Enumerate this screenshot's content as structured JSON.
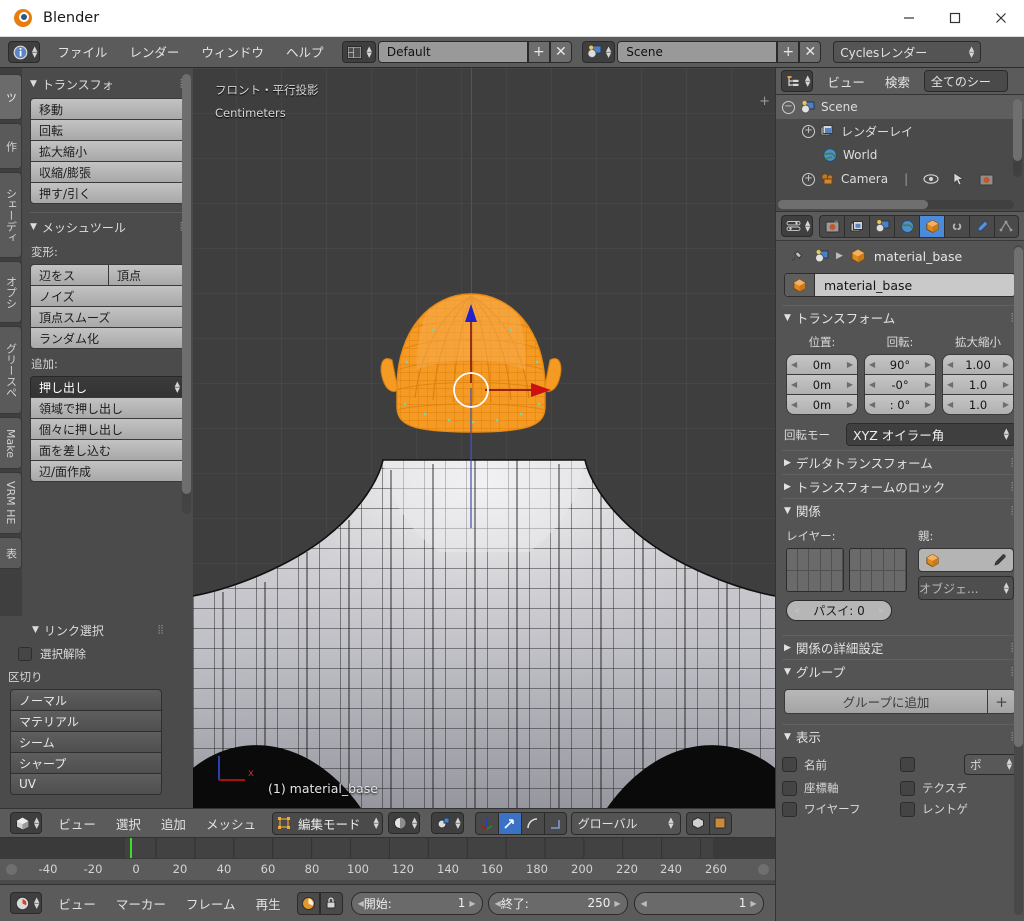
{
  "window": {
    "title": "Blender",
    "minimize_label": "—",
    "maximize_label": "□",
    "close_label": "✕"
  },
  "topbar": {
    "editor_icon": "info-editor-icon",
    "menus": [
      "ファイル",
      "レンダー",
      "ウィンドウ",
      "ヘルプ"
    ],
    "screen_layout": "Default",
    "screen_add": "+",
    "screen_remove": "✕",
    "scene_name": "Scene",
    "scene_add": "+",
    "scene_remove": "✕",
    "render_engine": "Cyclesレンダー"
  },
  "toolshelf": {
    "vertical_tabs": [
      {
        "label": "ツ",
        "active": true
      },
      {
        "label": "作",
        "active": false
      },
      {
        "label": "シェーディ",
        "active": false
      },
      {
        "label": "オプシ",
        "active": false
      },
      {
        "label": "グリースペ",
        "active": false
      },
      {
        "label": "Make",
        "active": false
      },
      {
        "label": "VRM HE",
        "active": false
      },
      {
        "label": "表",
        "active": false
      }
    ],
    "transform_panel": {
      "title": "トランスフォ",
      "buttons": [
        "移動",
        "回転",
        "拡大縮小",
        "収縮/膨張",
        "押す/引く"
      ]
    },
    "mesh_tools_panel": {
      "title": "メッシュツール",
      "deform_label": "変形:",
      "deform_split": [
        "辺をス",
        "頂点"
      ],
      "deform_buttons": [
        "ノイズ",
        "頂点スムーズ",
        "ランダム化"
      ],
      "add_label": "追加:",
      "add_active": "押し出し",
      "add_buttons": [
        "領域で押し出し",
        "個々に押し出し",
        "面を差し込む",
        "辺/面作成"
      ]
    },
    "link_select_panel": {
      "title": "リンク選択",
      "deselect_label": "選択解除",
      "delimit_label": "区切り",
      "delimit_buttons": [
        "ノーマル",
        "マテリアル",
        "シーム",
        "シャープ",
        "UV"
      ]
    }
  },
  "viewport": {
    "view_label": "フロント・平行投影",
    "unit_label": "Centimeters",
    "object_info": "(1) material_base",
    "axis_x_label": "x",
    "mesh_color": "#f59a23",
    "z_axis_color": "#3a4fa8",
    "x_axis_color": "#c31c1c",
    "toggle_panel": "+"
  },
  "viewport_header": {
    "editor_icon": "3d-view-editor-icon",
    "menus": [
      "ビュー",
      "選択",
      "追加",
      "メッシュ"
    ],
    "mode": "編集モード",
    "shading_icon": "solid-shading-icon",
    "pivot_icon": "pivot-median-icon",
    "manipulator_icons": [
      "translate-manipulator-icon",
      "rotate-manipulator-icon",
      "scale-manipulator-icon"
    ],
    "manipulator_active_index": 0,
    "orientation": "グローバル"
  },
  "timeline": {
    "ticks": [
      "-40",
      "-20",
      "0",
      "20",
      "40",
      "60",
      "80",
      "100",
      "120",
      "140",
      "160",
      "180",
      "200",
      "220",
      "240",
      "260"
    ],
    "playhead_frame": 0,
    "menus": [
      "ビュー",
      "マーカー",
      "フレーム",
      "再生"
    ],
    "start_label": "開始:",
    "start_value": "1",
    "end_label": "終了:",
    "end_value": "250",
    "current_frame": "1",
    "auto_key_icon": "auto-keyframe-icon",
    "lock_icon": "lock-icon"
  },
  "outliner": {
    "editor_icon": "outliner-editor-icon",
    "menus": [
      "ビュー",
      "検索"
    ],
    "display_mode": "全てのシー",
    "rows": [
      {
        "label": "Scene",
        "icon": "scene-icon",
        "indent": 0,
        "expander": "−",
        "selected": true
      },
      {
        "label": "レンダーレイ",
        "icon": "render-layers-icon",
        "indent": 1,
        "expander": "+",
        "selected": false
      },
      {
        "label": "World",
        "icon": "world-icon",
        "indent": 1,
        "expander": "",
        "selected": false
      },
      {
        "label": "Camera",
        "icon": "camera-icon",
        "indent": 1,
        "expander": "+",
        "selected": false
      }
    ],
    "row_icons": [
      "eye-icon",
      "cursor-icon",
      "render-icon"
    ]
  },
  "properties": {
    "tabs": [
      {
        "name": "render-tab-icon",
        "active": false
      },
      {
        "name": "render-layers-tab-icon",
        "active": false
      },
      {
        "name": "scene-tab-icon",
        "active": false
      },
      {
        "name": "world-tab-icon",
        "active": false
      },
      {
        "name": "object-tab-icon",
        "active": true
      },
      {
        "name": "constraints-tab-icon",
        "active": false
      },
      {
        "name": "modifiers-tab-icon",
        "active": false
      },
      {
        "name": "data-tab-icon",
        "active": false
      }
    ],
    "breadcrumb_pin_icon": "pin-icon",
    "breadcrumb_scene_icon": "scene-icon",
    "breadcrumb_object": "material_base",
    "object_name": "material_base",
    "transform": {
      "title": "トランスフォーム",
      "location_label": "位置:",
      "rotation_label": "回転:",
      "scale_label": "拡大縮小",
      "location": [
        "0m",
        "0m",
        "0m"
      ],
      "rotation": [
        "90°",
        "-0°",
        ": 0°"
      ],
      "scale": [
        "1.00",
        "1.0",
        "1.0"
      ],
      "rotation_mode_label": "回転モー",
      "rotation_mode_value": "XYZ オイラー角"
    },
    "delta_transform_title": "デルタトランスフォーム",
    "transform_lock_title": "トランスフォームのロック",
    "relations": {
      "title": "関係",
      "layers_label": "レイヤー:",
      "parent_label": "親:",
      "parent_value": "",
      "parent_type": "オブジェ...",
      "pass_index": "パスイ: 0"
    },
    "relations_extra_title": "関係の詳細設定",
    "group": {
      "title": "グループ",
      "add_label": "グループに追加",
      "add_plus": "+"
    },
    "display": {
      "title": "表示",
      "items": [
        "名前",
        "座標軸",
        "ワイヤーフ"
      ],
      "items_right": [
        "",
        "テクスチ",
        "レントゲ"
      ],
      "max_draw_type": "ポ"
    }
  }
}
